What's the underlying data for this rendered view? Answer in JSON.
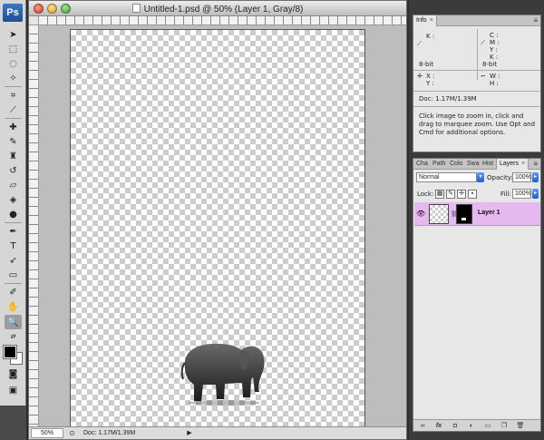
{
  "app": {
    "logo": "Ps"
  },
  "document": {
    "title": "Untitled-1.psd @ 50% (Layer 1, Gray/8)",
    "zoom": "50%",
    "doc_status": "Doc: 1.17M/1.39M"
  },
  "info_panel": {
    "tab_label": "Info",
    "k_label": "K :",
    "c_label": "C :",
    "m_label": "M :",
    "y_label": "Y :",
    "k2_label": "K :",
    "bit_left": "8-bit",
    "bit_right": "8-bit",
    "x_label": "X :",
    "ycoord_label": "Y :",
    "w_label": "W :",
    "h_label": "H :",
    "doc_size": "Doc: 1.17M/1.39M",
    "hint": "Click image to zoom in, click and drag to marquee zoom.  Use Opt and Cmd for additional options."
  },
  "layers_panel": {
    "tabs": [
      "Cha",
      "Path",
      "Colo",
      "Swa",
      "Hist",
      "Layers"
    ],
    "active_tab": "Layers",
    "blend_mode": "Normal",
    "opacity_label": "Opacity:",
    "opacity_value": "100%",
    "lock_label": "Lock:",
    "fill_label": "Fill:",
    "fill_value": "100%",
    "layers": [
      {
        "name": "Layer 1",
        "visible": true,
        "selected": true
      }
    ]
  },
  "icons": {
    "eye": "eye-icon",
    "link": "link-icon"
  },
  "colors": {
    "foreground": "#000000",
    "background": "#ffffff",
    "layer_selected": "#e6b8f0"
  }
}
